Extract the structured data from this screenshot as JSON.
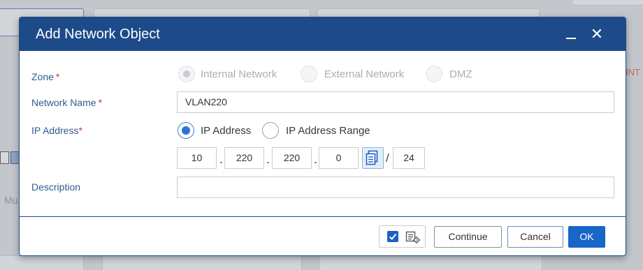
{
  "dialog": {
    "title": "Add Network Object"
  },
  "form": {
    "zone_label": "Zone",
    "required_mark": "*",
    "zone_options": [
      "Internal Network",
      "External Network",
      "DMZ"
    ],
    "network_name_label": "Network Name",
    "network_name_value": "VLAN220",
    "ip_address_label": "IP Address",
    "ip_type_options": [
      "IP Address",
      "IP Address Range"
    ],
    "octets": [
      "10",
      "220",
      "220",
      "0"
    ],
    "dot": ".",
    "slash": "/",
    "prefix": "24",
    "description_label": "Description",
    "description_value": ""
  },
  "footer": {
    "continue_label": "Continue",
    "cancel_label": "Cancel",
    "ok_label": "OK"
  },
  "background": {
    "partial_text_left": "Mu",
    "partial_text_right": "INT"
  },
  "colors": {
    "titlebar": "#1d4a88",
    "accent": "#1766c8",
    "label": "#2d5c8f",
    "required": "#c0392b"
  }
}
